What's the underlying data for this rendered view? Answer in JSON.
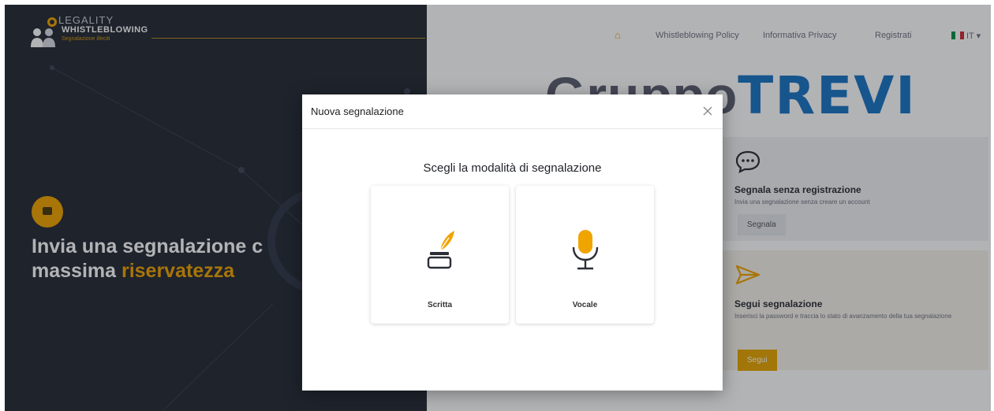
{
  "header": {
    "logo_line1": "LEGALITY",
    "logo_line2": "WHISTLEBLOWING",
    "logo_line3": "Segnalazione illeciti"
  },
  "nav": {
    "home_icon": "home-icon",
    "items": [
      {
        "label": "Whistleblowing Policy"
      },
      {
        "label": "Informativa Privacy"
      },
      {
        "label": "Registrati"
      }
    ],
    "language": "IT",
    "flag_colors": [
      "#009246",
      "#ffffff",
      "#ce2b37"
    ]
  },
  "brand": {
    "prefix": "Gruppo",
    "name": "TREVI",
    "color": "#1b75c4"
  },
  "hero": {
    "line1": "Invia una segnalazione c",
    "line2_plain": "massima ",
    "line2_accent": "riservatezza",
    "accent_color": "#f0a400"
  },
  "cards": [
    {
      "icon": "chat-bubble-icon",
      "title": "Segnala senza registrazione",
      "description": "Invia una segnalazione senza creare un account",
      "button": "Segnala"
    },
    {
      "icon": "paper-plane-icon",
      "title": "Segui segnalazione",
      "description": "Inserisci la password e traccia lo stato di avanzamento della tua segnalazione",
      "button": "Segui"
    }
  ],
  "modal": {
    "title": "Nuova segnalazione",
    "close_icon": "close-icon",
    "heading": "Scegli la modalità di segnalazione",
    "options": [
      {
        "label": "Scritta",
        "icon": "quill-inkpot-icon"
      },
      {
        "label": "Vocale",
        "icon": "microphone-icon"
      }
    ]
  },
  "colors": {
    "accent": "#f0a400",
    "dark_bg": "#262b36"
  }
}
